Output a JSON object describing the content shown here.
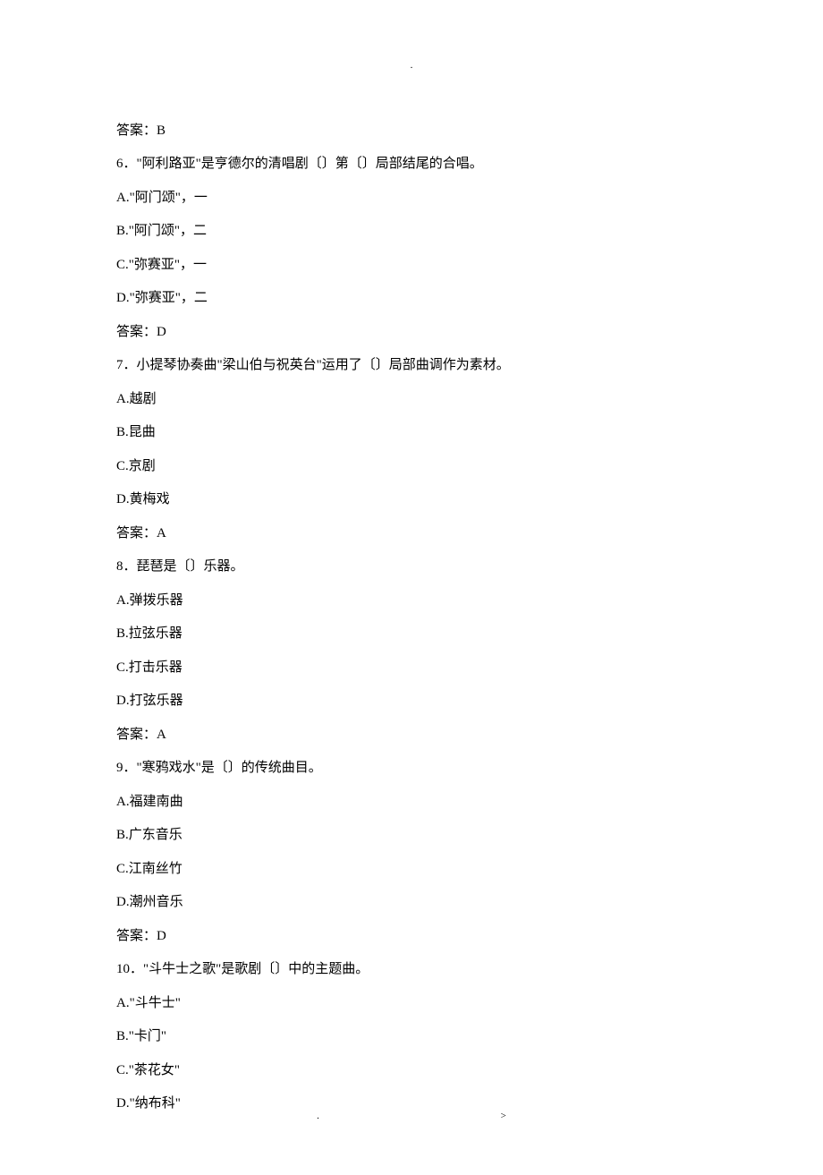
{
  "top_marker": ".",
  "lines": [
    "答案：B",
    "6．\"阿利路亚\"是亨德尔的清唱剧〔〕第〔〕局部结尾的合唱。",
    "A.\"阿门颂\"，一",
    "B.\"阿门颂\"，二",
    "C.\"弥赛亚\"，一",
    "D.\"弥赛亚\"，二",
    "答案：D",
    "7．小提琴协奏曲\"梁山伯与祝英台\"运用了〔〕局部曲调作为素材。",
    "A.越剧",
    "B.昆曲",
    "C.京剧",
    "D.黄梅戏",
    "答案：A",
    "8．琵琶是〔〕乐器。",
    "A.弹拨乐器",
    "B.拉弦乐器",
    "C.打击乐器",
    "D.打弦乐器",
    "答案：A",
    "9．\"寒鸦戏水\"是〔〕的传统曲目。",
    "A.福建南曲",
    "B.广东音乐",
    "C.江南丝竹",
    "D.潮州音乐",
    "答案：D",
    "10．\"斗牛士之歌\"是歌剧〔〕中的主题曲。",
    "A.\"斗牛士\"",
    "B.\"卡门\"",
    "C.\"茶花女\"",
    "D.\"纳布科\""
  ],
  "footer_left": ".",
  "footer_right": ">"
}
